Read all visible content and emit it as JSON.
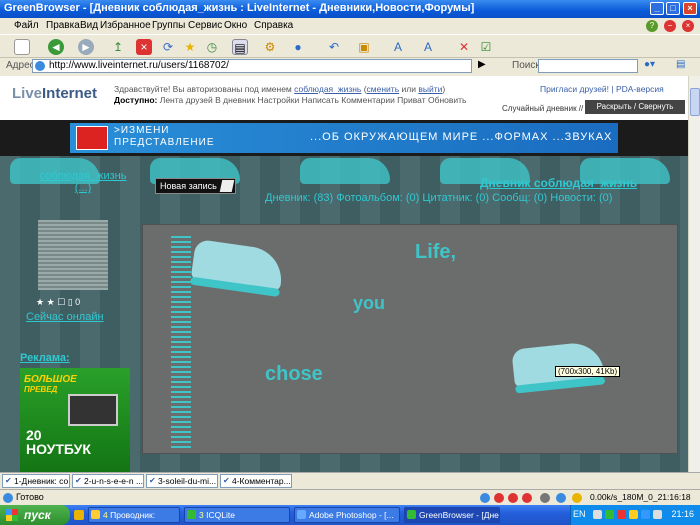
{
  "window": {
    "title": "GreenBrowser - [Дневник соблюдая_жизнь : LiveInternet - Дневники,Новости,Форумы]"
  },
  "menu": [
    "Файл",
    "Правка",
    "Вид",
    "Избранное",
    "Группы",
    "Сервис",
    "Окно",
    "Справка"
  ],
  "address": {
    "label": "Адрес",
    "url": "http://www.liveinternet.ru/users/1168702/",
    "search_label": "Поиск:"
  },
  "li": {
    "logo_a": "Live",
    "logo_b": "Internet",
    "greeting_pre": "Здравствуйте! Вы авторизованы под именем",
    "username": "соблюдая_жизнь",
    "change": "сменить",
    "or": "или",
    "logout": "выйти",
    "nav_label": "Доступно:",
    "nav_items": "Лента друзей В дневник Настройки Написать Комментарии Приват Обновить",
    "invite": "Пригласи друзей!",
    "pda": "PDA-версия",
    "random": "Случайный дневник //",
    "expand": "Раскрыть / Свернуть"
  },
  "banner": {
    "line1": ">ИЗМЕНИ",
    "line2": "ПРЕДСТАВЛЕНИЕ",
    "line3": "...ОБ ОКРУЖАЮЩЕМ МИРЕ   ...ФОРМАХ   ...ЗВУКАХ"
  },
  "diary": {
    "title": "Дневник соблюдая_жизнь",
    "stats": "Дневник: (83) Фотоальбом: (0) Цитатник: (0) Сообщ: (0) Новости: (0)",
    "new_post": "Новая запись",
    "side_name": "соблюдая_жизнь (...)",
    "rating": "★ ★ ☐ ▯ 0",
    "online": "Сейчас онлайн",
    "ads_label": "Реклама:",
    "ad_top": "БОЛЬШОЕ",
    "ad_sub": "ПРЕВЕД",
    "ad_big1": "20",
    "ad_big2": "НОУТБУК"
  },
  "post_image": {
    "word1": "Life,",
    "word2": "you",
    "word3": "chose",
    "tooltip": "(700x300, 41Kb)"
  },
  "tabs": [
    "1-Дневник: со...",
    "2-u-n-s-e-e-n ...",
    "3-soleil-du-mi...",
    "4-Комментар..."
  ],
  "status": {
    "text": "Готово",
    "stats": "0.00k/s_180M_0_21:16:18"
  },
  "taskbar": {
    "start": "пуск",
    "tasks": [
      {
        "num": "4",
        "label": "Проводник:"
      },
      {
        "num": "3",
        "label": "ICQLite"
      },
      {
        "num": "",
        "label": "Adobe Photoshop - [..."
      },
      {
        "num": "",
        "label": "GreenBrowser - [Дне..."
      }
    ],
    "lang": "EN",
    "clock": "21:16"
  }
}
